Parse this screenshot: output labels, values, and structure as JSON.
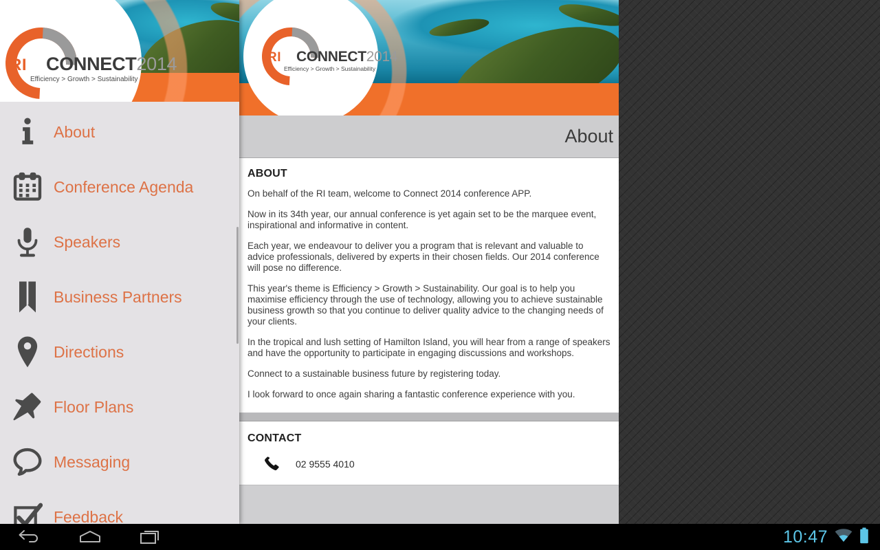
{
  "brand": {
    "logo_ri": "RI",
    "logo_connect": "CONNECT",
    "logo_year": "2014",
    "logo_tagline": "Efficiency > Growth > Sustainability",
    "accent_orange": "#f0702a",
    "text_orange": "#dd7246",
    "drawer_bg": "#e4e2e5",
    "titlebar_bg": "#cdcdcf"
  },
  "drawer": {
    "items": [
      {
        "label": "About",
        "icon": "info-icon"
      },
      {
        "label": "Conference Agenda",
        "icon": "calendar-icon"
      },
      {
        "label": "Speakers",
        "icon": "microphone-icon"
      },
      {
        "label": "Business Partners",
        "icon": "bookmark-icon"
      },
      {
        "label": "Directions",
        "icon": "map-pin-icon"
      },
      {
        "label": "Floor Plans",
        "icon": "pushpin-icon"
      },
      {
        "label": "Messaging",
        "icon": "speech-bubble-icon"
      },
      {
        "label": "Feedback",
        "icon": "checkbox-checked-icon"
      }
    ]
  },
  "page": {
    "title": "About",
    "about": {
      "heading": "ABOUT",
      "paragraphs": [
        "On behalf of the RI team, welcome to Connect 2014 conference APP.",
        "Now in its 34th year, our annual conference is yet again set to be the marquee event, inspirational and informative in content.",
        "Each year, we endeavour to deliver you a program that is relevant and valuable to advice professionals, delivered by experts in their chosen fields. Our 2014 conference will pose no difference.",
        "This year's theme is Efficiency > Growth > Sustainability. Our goal is to help you maximise efficiency through the use of technology, allowing you to achieve sustainable business growth so that you continue to deliver quality advice to the changing needs of your clients.",
        "In the tropical and lush setting of Hamilton Island, you will hear from a range of speakers and have the opportunity to participate in engaging discussions and workshops.",
        "Connect to a sustainable business future by registering today.",
        "I look forward to once again sharing a fantastic conference experience with you."
      ]
    },
    "contact": {
      "heading": "CONTACT",
      "phone_icon": "phone-icon",
      "phone": "02 9555 4010"
    }
  },
  "system_bar": {
    "back": "back-icon",
    "home": "home-icon",
    "recents": "recents-icon",
    "clock": "10:47",
    "wifi": "wifi-icon",
    "battery": "battery-icon",
    "accent": "#5cc6e8"
  }
}
